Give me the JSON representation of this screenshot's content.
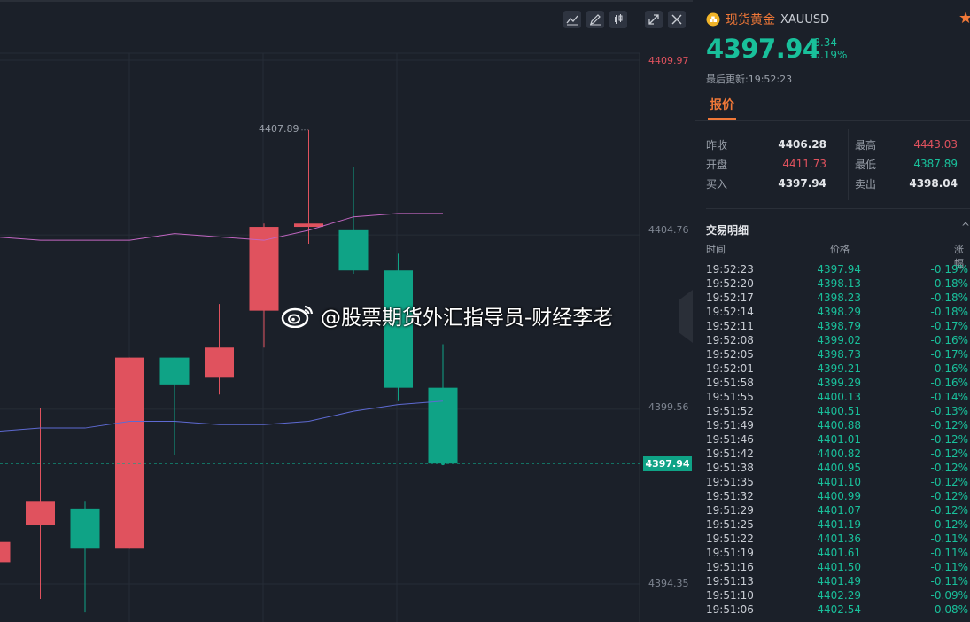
{
  "chart": {
    "price_labels": [
      {
        "text": "4409.97",
        "color": "#e0525e"
      },
      {
        "text": "4404.76",
        "color": "#7e8591"
      },
      {
        "text": "4399.56",
        "color": "#7e8591"
      },
      {
        "text": "4394.35",
        "color": "#7e8591"
      }
    ],
    "current_price_tag": "4397.94",
    "high_marker": "4407.89",
    "watermark": "@股票期货外汇指导员-财经李老",
    "toolbar_icons": [
      "line-tool-icon",
      "pencil-icon",
      "candlestick-icon",
      "expand-icon",
      "close-icon"
    ],
    "colors": {
      "up": "#e0525e",
      "down": "#0fa386",
      "ma_upper": "#c266c2",
      "ma_lower": "#5e6ad2",
      "background": "#1b2029"
    }
  },
  "chart_data": {
    "type": "candlestick",
    "y_axis_ticks": [
      4409.97,
      4404.76,
      4399.56,
      4394.35
    ],
    "current_price": 4397.94,
    "annotated_high": 4407.89,
    "candles": [
      {
        "open": 4395.0,
        "close": 4395.6,
        "high": 4395.8,
        "low": 4394.8
      },
      {
        "open": 4396.1,
        "close": 4396.8,
        "high": 4399.6,
        "low": 4393.9
      },
      {
        "open": 4396.6,
        "close": 4395.4,
        "high": 4396.8,
        "low": 4393.5
      },
      {
        "open": 4395.4,
        "close": 4401.1,
        "high": 4401.1,
        "low": 4395.4
      },
      {
        "open": 4401.1,
        "close": 4400.3,
        "high": 4401.1,
        "low": 4398.2
      },
      {
        "open": 4400.5,
        "close": 4401.4,
        "high": 4402.7,
        "low": 4400.0
      },
      {
        "open": 4402.5,
        "close": 4405.0,
        "high": 4405.1,
        "low": 4401.4
      },
      {
        "open": 4405.0,
        "close": 4405.1,
        "high": 4407.89,
        "low": 4404.5
      },
      {
        "open": 4404.9,
        "close": 4403.7,
        "high": 4406.8,
        "low": 4403.6
      },
      {
        "open": 4403.7,
        "close": 4400.2,
        "high": 4404.2,
        "low": 4399.8
      },
      {
        "open": 4400.2,
        "close": 4397.94,
        "high": 4401.5,
        "low": 4397.9
      }
    ],
    "ma_upper": [
      4404.7,
      4404.6,
      4404.6,
      4404.6,
      4404.8,
      4404.7,
      4404.6,
      4404.9,
      4405.3,
      4405.4,
      4405.4
    ],
    "ma_lower": [
      4398.9,
      4399.0,
      4399.0,
      4399.2,
      4399.2,
      4399.1,
      4399.1,
      4399.2,
      4399.5,
      4399.7,
      4399.8
    ]
  },
  "panel": {
    "symbol_name": "现货黄金",
    "symbol_code": "XAUUSD",
    "price": "4397.94",
    "change": "-8.34",
    "change_pct": "-0.19%",
    "last_update": "最后更新:19:52:23",
    "tab_label": "报价",
    "quote_rows": [
      {
        "l1": "昨收",
        "v1": "4406.28",
        "c1": "white",
        "l2": "最高",
        "v2": "4443.03",
        "c2": "red"
      },
      {
        "l1": "开盘",
        "v1": "4411.73",
        "c1": "red",
        "l2": "最低",
        "v2": "4387.89",
        "c2": "green"
      },
      {
        "l1": "买入",
        "v1": "4397.94",
        "c1": "white",
        "l2": "卖出",
        "v2": "4398.04",
        "c2": "white"
      }
    ],
    "trades_title": "交易明细",
    "col_time": "时间",
    "col_price": "价格",
    "col_change": "涨幅",
    "trades": [
      {
        "time": "19:52:23",
        "price": "4397.94",
        "pct": "-0.19%"
      },
      {
        "time": "19:52:20",
        "price": "4398.13",
        "pct": "-0.18%"
      },
      {
        "time": "19:52:17",
        "price": "4398.23",
        "pct": "-0.18%"
      },
      {
        "time": "19:52:14",
        "price": "4398.29",
        "pct": "-0.18%"
      },
      {
        "time": "19:52:11",
        "price": "4398.79",
        "pct": "-0.17%"
      },
      {
        "time": "19:52:08",
        "price": "4399.02",
        "pct": "-0.16%"
      },
      {
        "time": "19:52:05",
        "price": "4398.73",
        "pct": "-0.17%"
      },
      {
        "time": "19:52:01",
        "price": "4399.21",
        "pct": "-0.16%"
      },
      {
        "time": "19:51:58",
        "price": "4399.29",
        "pct": "-0.16%"
      },
      {
        "time": "19:51:55",
        "price": "4400.13",
        "pct": "-0.14%"
      },
      {
        "time": "19:51:52",
        "price": "4400.51",
        "pct": "-0.13%"
      },
      {
        "time": "19:51:49",
        "price": "4400.88",
        "pct": "-0.12%"
      },
      {
        "time": "19:51:46",
        "price": "4401.01",
        "pct": "-0.12%"
      },
      {
        "time": "19:51:42",
        "price": "4400.82",
        "pct": "-0.12%"
      },
      {
        "time": "19:51:38",
        "price": "4400.95",
        "pct": "-0.12%"
      },
      {
        "time": "19:51:35",
        "price": "4401.10",
        "pct": "-0.12%"
      },
      {
        "time": "19:51:32",
        "price": "4400.99",
        "pct": "-0.12%"
      },
      {
        "time": "19:51:29",
        "price": "4401.07",
        "pct": "-0.12%"
      },
      {
        "time": "19:51:25",
        "price": "4401.19",
        "pct": "-0.12%"
      },
      {
        "time": "19:51:22",
        "price": "4401.36",
        "pct": "-0.11%"
      },
      {
        "time": "19:51:19",
        "price": "4401.61",
        "pct": "-0.11%"
      },
      {
        "time": "19:51:16",
        "price": "4401.50",
        "pct": "-0.11%"
      },
      {
        "time": "19:51:13",
        "price": "4401.49",
        "pct": "-0.11%"
      },
      {
        "time": "19:51:10",
        "price": "4402.29",
        "pct": "-0.09%"
      },
      {
        "time": "19:51:06",
        "price": "4402.54",
        "pct": "-0.08%"
      }
    ]
  }
}
